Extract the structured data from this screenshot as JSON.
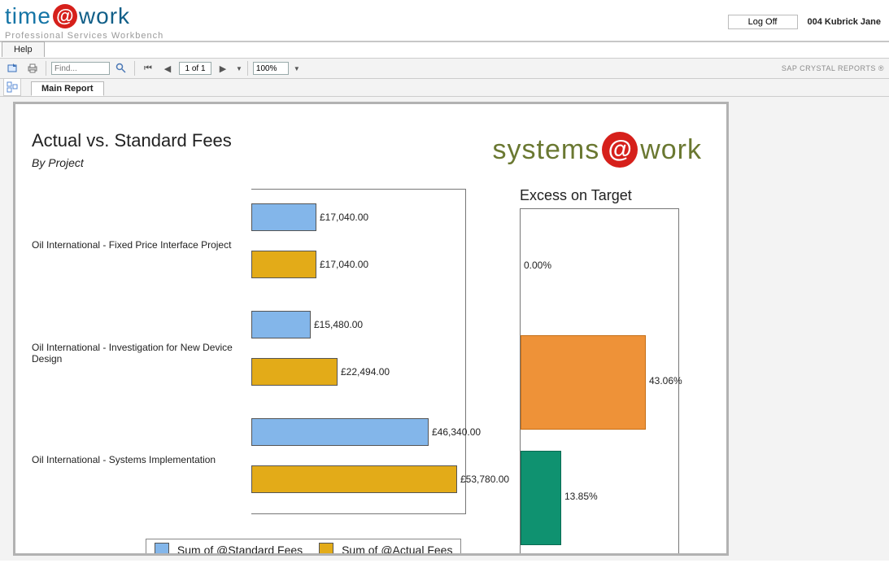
{
  "header": {
    "logo_left": "time",
    "logo_at": "@",
    "logo_right": "work",
    "tagline": "Professional Services Workbench",
    "logoff_label": "Log Off",
    "user_label": "004 Kubrick Jane"
  },
  "menu": {
    "help": "Help"
  },
  "toolbar": {
    "find_placeholder": "Find...",
    "page_current": "1 of 1",
    "zoom_value": "100%",
    "brand_right": "SAP CRYSTAL REPORTS ®"
  },
  "report_tab": {
    "main": "Main Report"
  },
  "report": {
    "title": "Actual vs. Standard Fees",
    "subtitle": "By Project",
    "brand_left": "systems",
    "brand_right": "work",
    "legend_std": "Sum of @Standard Fees",
    "legend_act": "Sum of @Actual Fees",
    "excess_title": "Excess on Target",
    "projects": [
      {
        "name": "Oil International - Fixed Price Interface Project",
        "std_label": "£17,040.00",
        "act_label": "£17,040.00"
      },
      {
        "name": "Oil International - Investigation for New Device Design",
        "std_label": "£15,480.00",
        "act_label": "£22,494.00"
      },
      {
        "name": "Oil International - Systems Implementation",
        "std_label": "£46,340.00",
        "act_label": "£53,780.00"
      }
    ],
    "excess": [
      {
        "label": "0.00%"
      },
      {
        "label": "43.06%"
      },
      {
        "label": "13.85%"
      }
    ]
  },
  "chart_data": [
    {
      "type": "bar",
      "title": "Actual vs. Standard Fees",
      "subtitle": "By Project",
      "orientation": "horizontal",
      "categories": [
        "Oil International - Fixed Price Interface Project",
        "Oil International - Investigation for New Device Design",
        "Oil International - Systems Implementation"
      ],
      "series": [
        {
          "name": "Sum of @Standard Fees",
          "values": [
            17040.0,
            15480.0,
            46340.0
          ],
          "color": "#83b6ea"
        },
        {
          "name": "Sum of @Actual Fees",
          "values": [
            17040.0,
            22494.0,
            53780.0
          ],
          "color": "#e3ab18"
        }
      ],
      "currency": "GBP",
      "xlim": [
        0,
        55000
      ]
    },
    {
      "type": "bar",
      "title": "Excess on Target",
      "categories": [
        "Oil International - Fixed Price Interface Project",
        "Oil International - Investigation for New Device Design",
        "Oil International - Systems Implementation"
      ],
      "values": [
        0.0,
        43.06,
        13.85
      ],
      "unit": "percent",
      "ylim": [
        0,
        100
      ],
      "colors": [
        "#ffffff",
        "#ee9238",
        "#0f9270"
      ]
    }
  ]
}
